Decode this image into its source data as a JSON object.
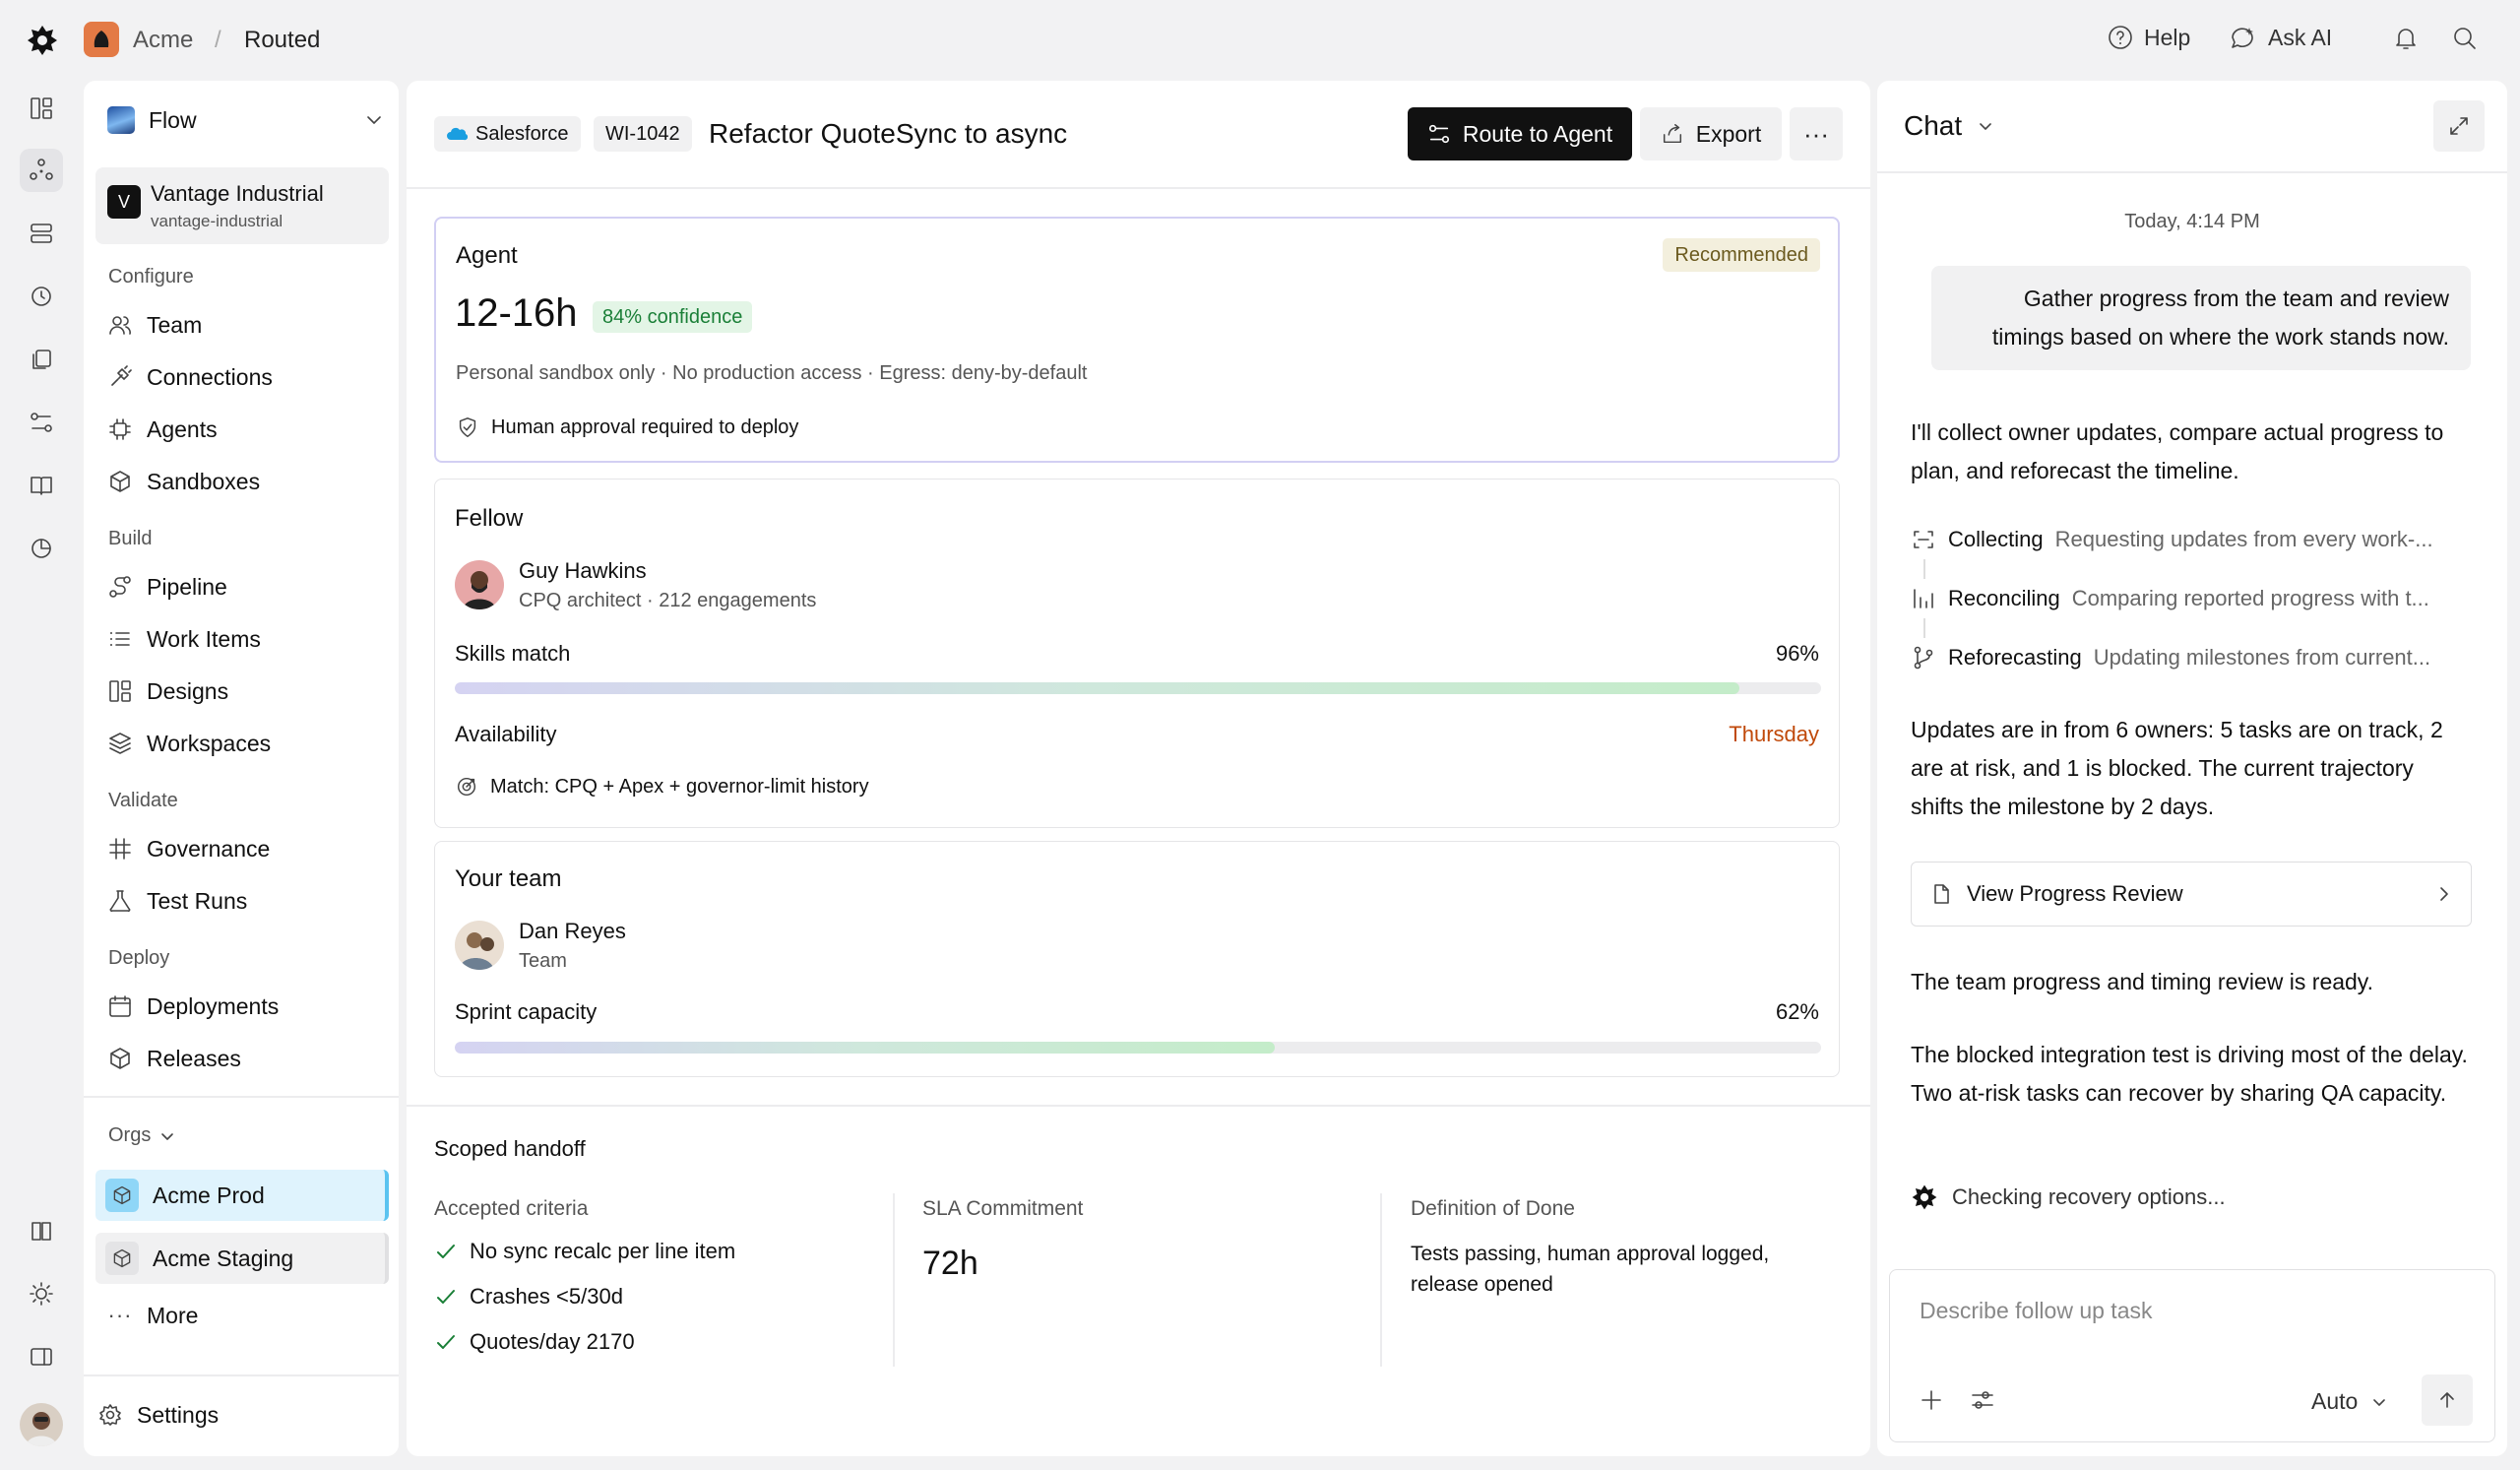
{
  "breadcrumb": {
    "org": "Acme",
    "page": "Routed"
  },
  "top_actions": {
    "help": "Help",
    "ask_ai": "Ask AI"
  },
  "sidebar": {
    "workspace": "Flow",
    "account": {
      "initial": "V",
      "name": "Vantage Industrial",
      "slug": "vantage-industrial"
    },
    "sections": {
      "configure": "Configure",
      "build": "Build",
      "validate": "Validate",
      "deploy": "Deploy"
    },
    "items": {
      "team": "Team",
      "connections": "Connections",
      "agents": "Agents",
      "sandboxes": "Sandboxes",
      "pipeline": "Pipeline",
      "work_items": "Work Items",
      "designs": "Designs",
      "workspaces": "Workspaces",
      "governance": "Governance",
      "test_runs": "Test Runs",
      "deployments": "Deployments",
      "releases": "Releases"
    },
    "orgs_label": "Orgs",
    "orgs": [
      "Acme Prod",
      "Acme Staging"
    ],
    "more": "More",
    "settings": "Settings"
  },
  "main": {
    "source": "Salesforce",
    "work_item_id": "WI-1042",
    "title": "Refactor QuoteSync to async",
    "route_button": "Route to Agent",
    "export_button": "Export",
    "agent": {
      "title": "Agent",
      "badge": "Recommended",
      "estimate": "12-16h",
      "confidence": "84% confidence",
      "constraints": "Personal sandbox only · No production access · Egress: deny-by-default",
      "approval": "Human approval required to deploy"
    },
    "fellow": {
      "title": "Fellow",
      "name": "Guy Hawkins",
      "role": "CPQ architect · 212 engagements",
      "skills_label": "Skills match",
      "skills_value": "96%",
      "skills_fraction": 0.94,
      "availability_label": "Availability",
      "availability_value": "Thursday",
      "match": "Match: CPQ + Apex + governor-limit history"
    },
    "team": {
      "title": "Your team",
      "name": "Dan Reyes",
      "role": "Team",
      "capacity_label": "Sprint capacity",
      "capacity_value": "62%",
      "capacity_fraction": 0.6
    },
    "handoff": {
      "title": "Scoped handoff",
      "criteria_label": "Accepted criteria",
      "criteria": [
        "No sync recalc per line item",
        "Crashes <5/30d",
        "Quotes/day 2170"
      ],
      "sla_label": "SLA Commitment",
      "sla_value": "72h",
      "dod_label": "Definition of Done",
      "dod_value": "Tests passing, human approval logged, release opened"
    }
  },
  "chat": {
    "title": "Chat",
    "timestamp": "Today, 4:14 PM",
    "user_message": "Gather progress from the team and review timings based on where the work stands now.",
    "reply_intro": "I'll collect owner updates, compare actual progress to plan, and reforecast the timeline.",
    "steps": [
      {
        "name": "Collecting",
        "desc": "Requesting updates from every work-..."
      },
      {
        "name": "Reconciling",
        "desc": "Comparing reported progress with t..."
      },
      {
        "name": "Reforecasting",
        "desc": "Updating milestones from current..."
      }
    ],
    "update_summary": "Updates are in from 6 owners: 5 tasks are on track, 2 are at risk, and 1 is blocked. The current trajectory shifts the milestone by 2 days.",
    "link_card": "View Progress Review",
    "ready": "The team progress and timing review is ready.",
    "analysis": "The blocked integration test is driving most of the delay. Two at-risk tasks can recover by sharing QA capacity.",
    "status": "Checking recovery options...",
    "input_placeholder": "Describe follow up task",
    "model": "Auto"
  },
  "colors": {
    "accent_green": "#1a7f37",
    "orange": "#c0490a",
    "recommended_bg": "#f3efdd",
    "selected_org": "#dff3fd"
  }
}
